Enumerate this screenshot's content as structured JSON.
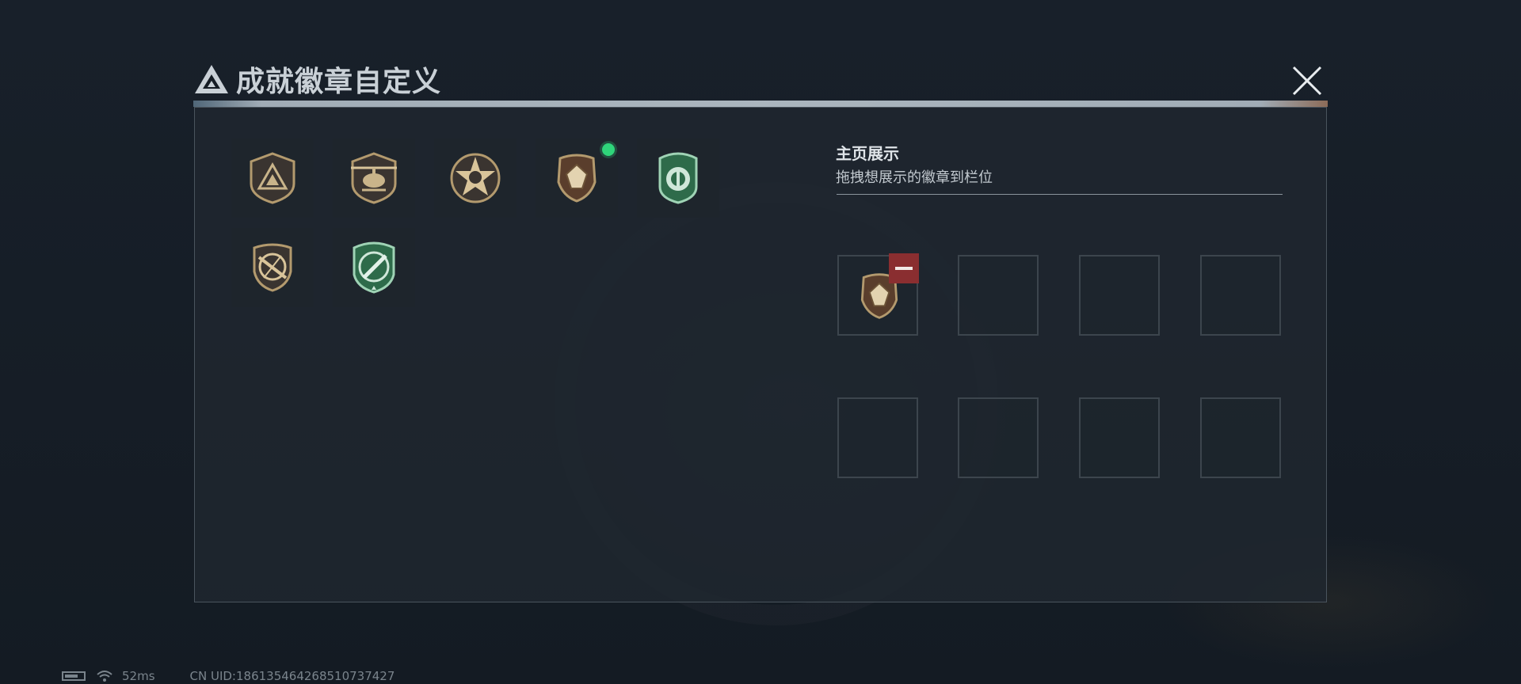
{
  "header": {
    "title": "成就徽章自定义",
    "logo_icon": "triangle-logo-icon",
    "close_icon": "close-icon"
  },
  "collection": {
    "badges": [
      {
        "name": "triangle-emblem-badge",
        "style": "bronze"
      },
      {
        "name": "helicopter-badge",
        "style": "bronze"
      },
      {
        "name": "star-skull-badge",
        "style": "bronze"
      },
      {
        "name": "gem-shield-badge",
        "style": "bronze",
        "new": true
      },
      {
        "name": "green-round-shield-badge",
        "style": "green"
      },
      {
        "name": "rifle-crossed-badge",
        "style": "bronze"
      },
      {
        "name": "green-knife-badge",
        "style": "green"
      }
    ]
  },
  "display": {
    "title": "主页展示",
    "subtitle": "拖拽想展示的徽章到栏位",
    "slots": [
      {
        "badge": "gem-shield-badge",
        "removable": true
      },
      {
        "badge": null
      },
      {
        "badge": null
      },
      {
        "badge": null
      },
      {
        "badge": null
      },
      {
        "badge": null
      },
      {
        "badge": null
      },
      {
        "badge": null
      }
    ]
  },
  "status_bar": {
    "ping": "52ms",
    "uid": "CN UID:1861354642685107374​27"
  },
  "colors": {
    "accent_green": "#2fd57a",
    "remove_red": "#8a2e30",
    "bronze": "#b39a6e",
    "badge_green": "#2e6b4a"
  }
}
